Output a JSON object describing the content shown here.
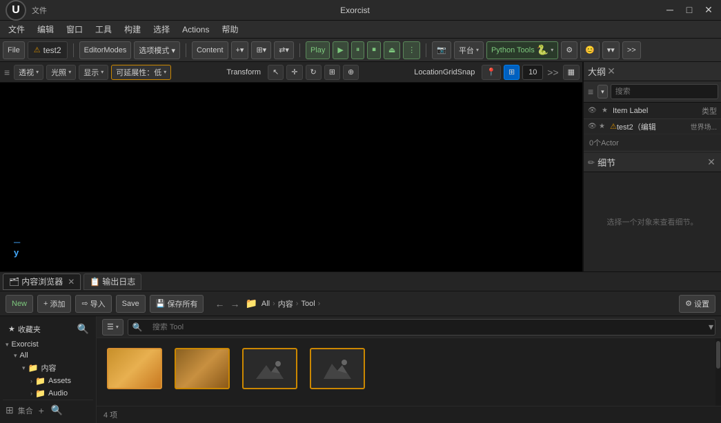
{
  "titlebar": {
    "title": "Exorcist",
    "tab": "test2",
    "min_label": "─",
    "max_label": "□",
    "close_label": "✕"
  },
  "menubar": {
    "items": [
      "文件",
      "编辑",
      "窗口",
      "工具",
      "构建",
      "选择",
      "Actions",
      "帮助"
    ]
  },
  "toolbar1": {
    "file_label": "File",
    "tab_label": "test2",
    "editor_modes_label": "EditorModes",
    "mode_btn_label": "选项模式 ▾",
    "content_label": "Content",
    "play_label": "Play",
    "platform_label": "平台",
    "python_tools_label": "Python Tools"
  },
  "viewport": {
    "toolbar": {
      "hamburger": "≡",
      "view_label": "透视",
      "light_label": "光照",
      "show_label": "显示",
      "extensibility_label": "可延展性：低",
      "transform_label": "Transform",
      "grid_label": "LocationGridSnap",
      "grid_value": "10"
    },
    "axis": {
      "x_label": "─",
      "y_label": "y"
    }
  },
  "outline_panel": {
    "title": "大纲",
    "search_placeholder": "搜索",
    "columns": {
      "label": "Item Label",
      "type": "类型"
    },
    "row": {
      "warning": "⚠",
      "name": "test2（编辑",
      "type": "世界场..."
    },
    "actor_count": "0个Actor"
  },
  "detail_panel": {
    "title": "细节",
    "content": "选择一个对象来查看细节。"
  },
  "bottom": {
    "tabs": [
      {
        "label": "内容浏览器",
        "active": true
      },
      {
        "label": "输出日志",
        "active": false
      }
    ],
    "toolbar": {
      "new_label": "New",
      "add_label": "添加",
      "import_label": "导入",
      "save_label": "Save",
      "save_all_label": "保存所有",
      "settings_label": "设置"
    },
    "breadcrumb": {
      "all": "All",
      "content": "内容",
      "tool": "Tool"
    },
    "search_placeholder": "搜索 Tool",
    "asset_count": "4 项",
    "sidebar": {
      "favorites_label": "收藏夹",
      "root_label": "Exorcist",
      "tree_items": [
        {
          "label": "All",
          "expanded": true
        },
        {
          "label": "内容",
          "expanded": true
        },
        {
          "label": "Assets",
          "expanded": false
        },
        {
          "label": "Audio",
          "expanded": false
        }
      ]
    },
    "assets": [
      {
        "type": "folder",
        "name": "",
        "style": "yellow"
      },
      {
        "type": "folder",
        "name": "",
        "style": "dark"
      },
      {
        "type": "image",
        "name": ""
      },
      {
        "type": "image",
        "name": ""
      }
    ]
  },
  "icons": {
    "hamburger": "≡",
    "chevron_right": "›",
    "chevron_down": "▾",
    "close": "✕",
    "eye": "👁",
    "star": "★",
    "search": "🔍",
    "plus": "+",
    "gear": "⚙",
    "folder": "📁",
    "pencil": "✏",
    "warning": "⚠",
    "list": "☰",
    "arrow_left": "‹",
    "arrow_right": "›",
    "grid": "⊞",
    "more": "⋮",
    "play": "▶",
    "pause": "⏸",
    "stop": "⏹",
    "camera": "📷"
  },
  "colors": {
    "accent_green": "#7dc87d",
    "accent_yellow": "#cc8800",
    "accent_blue": "#0060c0",
    "bg_dark": "#1a1a1a",
    "bg_panel": "#252525",
    "text_main": "#cccccc",
    "text_muted": "#888888"
  }
}
